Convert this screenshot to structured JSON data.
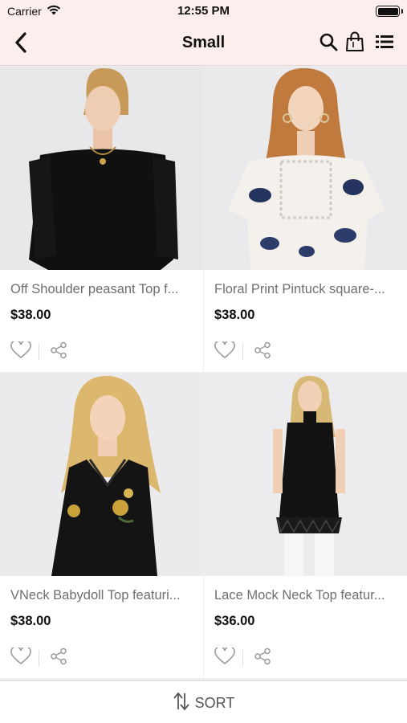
{
  "status_bar": {
    "carrier": "Carrier",
    "time": "12:55 PM",
    "battery_level": 1.0
  },
  "nav": {
    "title": "Small",
    "back_icon": "chevron-left-icon",
    "search_icon": "search-icon",
    "cart_icon": "shopping-bag-icon",
    "list_icon": "list-view-icon"
  },
  "products": [
    {
      "title": "Off Shoulder peasant Top f...",
      "price": "$38.00",
      "image": "black off-shoulder top"
    },
    {
      "title": "Floral Print Pintuck square-...",
      "price": "$38.00",
      "image": "white floral print top"
    },
    {
      "title": "VNeck Babydoll Top featuri...",
      "price": "$38.00",
      "image": "black embroidered babydoll top"
    },
    {
      "title": "Lace Mock Neck Top featur...",
      "price": "$36.00",
      "image": "black lace mock neck top"
    }
  ],
  "sort": {
    "label": "SORT",
    "icon": "sort-arrows-icon"
  },
  "colors": {
    "nav_background": "#fbeeec",
    "page_background": "#efefef",
    "title_text": "#6f6f6f",
    "price_text": "#111111"
  }
}
